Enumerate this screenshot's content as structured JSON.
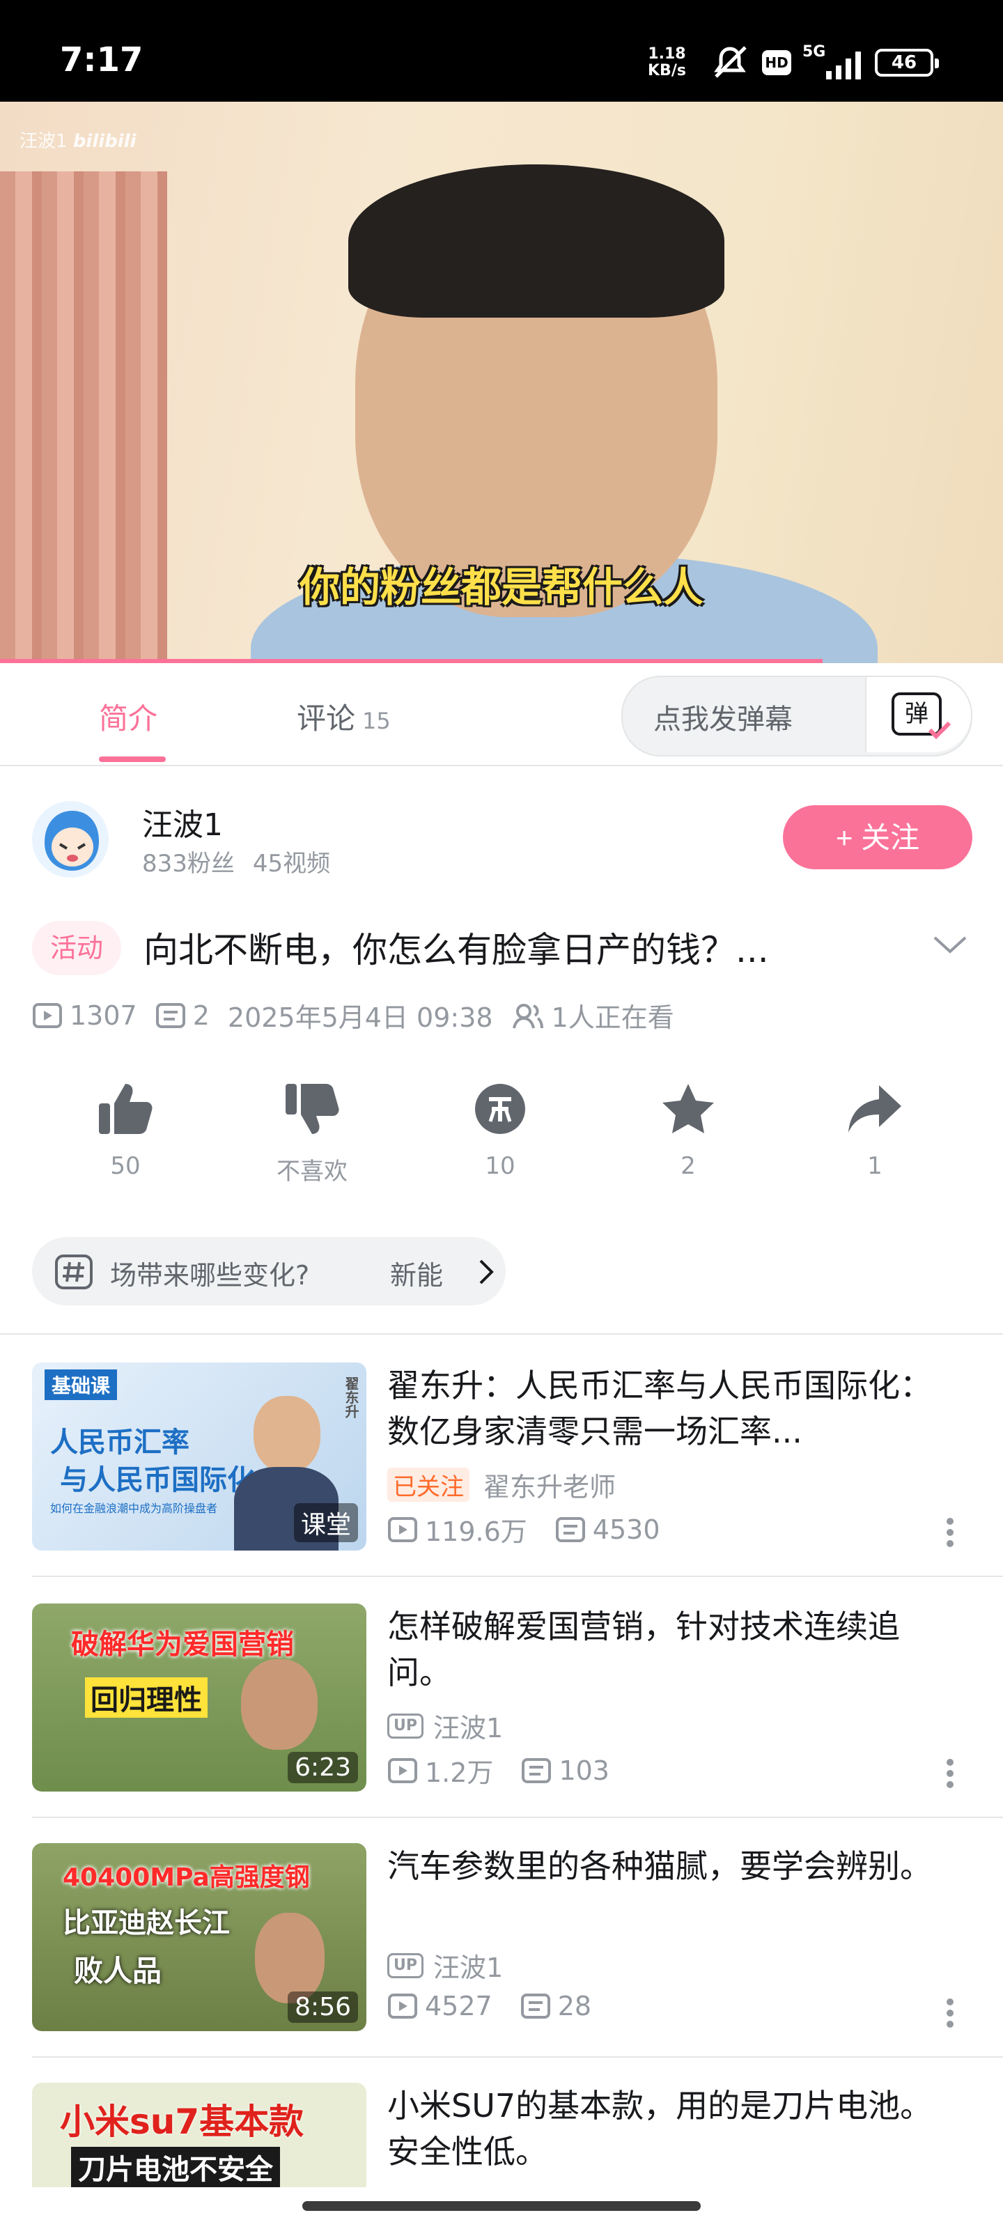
{
  "status_bar": {
    "time": "7:17",
    "speed_top": "1.18",
    "speed_bottom": "KB/s",
    "hd": "HD",
    "network": "5G",
    "battery": "46"
  },
  "video": {
    "watermark": "汪波1",
    "brand": "bilibili",
    "subtitle": "你的粉丝都是帮什么人",
    "progress_fraction": 0.82
  },
  "tabs": {
    "intro": "简介",
    "comments": "评论",
    "comments_count": "15",
    "danmaku_placeholder": "点我发弹幕",
    "danmaku_button": "弹"
  },
  "uploader": {
    "name": "汪波1",
    "fans": "833粉丝",
    "videos": "45视频",
    "follow_label": "+ 关注"
  },
  "video_info": {
    "tag": "活动",
    "title": "向北不断电，你怎么有脸拿日产的钱？...",
    "views": "1307",
    "danmaku_count": "2",
    "date": "2025年5月4日 09:38",
    "watching": "1人正在看"
  },
  "actions": [
    {
      "icon": "thumb-up-icon",
      "label": "50"
    },
    {
      "icon": "thumb-down-icon",
      "label": "不喜欢"
    },
    {
      "icon": "coin-icon",
      "label": "10"
    },
    {
      "icon": "star-icon",
      "label": "2"
    },
    {
      "icon": "share-icon",
      "label": "1"
    }
  ],
  "hashtag": {
    "text": "场带来哪些变化?",
    "text2": "新能"
  },
  "related": [
    {
      "title": "翟东升：人民币汇率与人民币国际化：数亿身家清零只需一场汇率...",
      "followed_badge": "已关注",
      "uploader": "翟东升老师",
      "views": "119.6万",
      "danmaku": "4530",
      "duration": "课堂",
      "thumb_top": "基础课",
      "thumb_line1": "人民币汇率",
      "thumb_line2": "与人民币国际化",
      "thumb_line3": "如何在金融浪潮中成为高阶操盘者",
      "thumb_name": "翟东升"
    },
    {
      "title": "怎样破解爱国营销，针对技术连续追问。",
      "up_badge": "UP",
      "uploader": "汪波1",
      "views": "1.2万",
      "danmaku": "103",
      "duration": "6:23",
      "thumb_line1": "破解华为爱国营销",
      "thumb_line2": "回归理性"
    },
    {
      "title": "汽车参数里的各种猫腻，要学会辨别。",
      "up_badge": "UP",
      "uploader": "汪波1",
      "views": "4527",
      "danmaku": "28",
      "duration": "8:56",
      "thumb_line1": "40400MPa高强度钢",
      "thumb_line2": "比亚迪赵长江",
      "thumb_line3": "败人品"
    },
    {
      "title": "小米SU7的基本款，用的是刀片电池。安全性低。",
      "thumb_line1": "小米su7基本款",
      "thumb_line2": "刀片电池不安全"
    }
  ]
}
